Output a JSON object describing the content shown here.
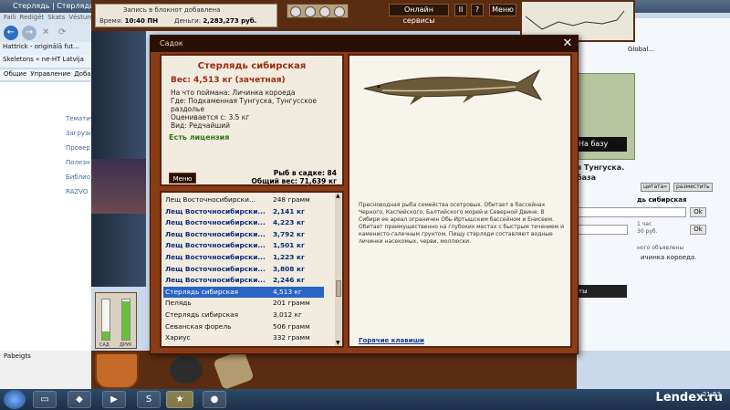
{
  "browser": {
    "title": "Стерлядь | Стерлядь сибир",
    "menu": [
      "Faili",
      "Rediģēt",
      "Skats",
      "Vēsture"
    ],
    "bookmarks": "Hattrick - originālā fut...",
    "tab": "Skeletons « ne-HT Latvija",
    "command_bar": [
      "Общие",
      "Управление",
      "Добавл"
    ],
    "left_links": [
      "Тематич",
      "Загрузи",
      "Провер",
      "Полезн",
      "Библио",
      "RAZVO"
    ],
    "right_tab_text": "Global...",
    "right_black_bar": "На базу",
    "right_bold_text": [
      "я Тунгуска.",
      "база"
    ],
    "right_buttons": [
      "цитата»",
      "разместить"
    ],
    "right_label": "дь сибирская",
    "right_ok": "Ok",
    "right_small": [
      "1 час",
      "30 руб.",
      "ного объявлены",
      "ичинка короеда."
    ],
    "right_dark_bar": "ты",
    "status": "Pabeigts"
  },
  "game": {
    "notebook_line1": "Запись в блокнот добавлена",
    "time_label": "Время:",
    "time_value": "10:40 ПН",
    "money_label": "Деньги:",
    "money_value": "2,283,273 руб.",
    "online_label": "Онлайн сервисы",
    "pause_label": "II",
    "help_label": "?",
    "menu_label": "Меню",
    "gauge_labels": [
      "САД",
      "ДРУК"
    ],
    "gauge_levels": [
      0.2,
      0.95
    ]
  },
  "dialog": {
    "title": "Садок",
    "fish_name": "Стерлядь сибирская",
    "weight_line": "Вес: 4,513 кг (зачетная)",
    "bait_line": "На что поймана: Личинка короеда",
    "where_line": "Где: Подкаменная Тунгуска, Тунгусское раздолье",
    "value_line": "Оценивается с: 3.5 кг",
    "kind_line": "Вид: Редчайший",
    "license": "Есть лицензия",
    "menu_button": "Меню",
    "fish_count": "Рыб в садке: 84",
    "total_weight": "Общий вес: 71,639 кг",
    "description": "Пресноводная рыба семейства осетровых. Обитает в бассейнах Черного, Каспийского, Балтийского морей и Северной Двине. В Сибири ее ареал ограничен Обь-Иртышским бассейном и Енисеем. Обитает преимущественно на глубоких местах с быстрым течением и каменисто-галечным грунтом. Пищу стерляди составляют водные личинки насекомых, черви, моллюски.",
    "hotkeys": "Горячие клавиши",
    "catch": [
      {
        "name": "Лещ Восточносибирски...",
        "weight": "248 грамм",
        "bold": false,
        "selected": false
      },
      {
        "name": "Лещ Восточносибирски...",
        "weight": "2,141 кг",
        "bold": true,
        "selected": false
      },
      {
        "name": "Лещ Восточносибирски...",
        "weight": "4,223 кг",
        "bold": true,
        "selected": false
      },
      {
        "name": "Лещ Восточносибирски...",
        "weight": "3,792 кг",
        "bold": true,
        "selected": false
      },
      {
        "name": "Лещ Восточносибирски...",
        "weight": "1,501 кг",
        "bold": true,
        "selected": false
      },
      {
        "name": "Лещ Восточносибирски...",
        "weight": "1,223 кг",
        "bold": true,
        "selected": false
      },
      {
        "name": "Лещ Восточносибирски...",
        "weight": "3,808 кг",
        "bold": true,
        "selected": false
      },
      {
        "name": "Лещ Восточносибирски...",
        "weight": "2,246 кг",
        "bold": true,
        "selected": false
      },
      {
        "name": "Стерлядь сибирская",
        "weight": "4,513 кг",
        "bold": false,
        "selected": true
      },
      {
        "name": "Пелядь",
        "weight": "201 грамм",
        "bold": false,
        "selected": false
      },
      {
        "name": "Стерлядь сибирская",
        "weight": "3,012 кг",
        "bold": false,
        "selected": false
      },
      {
        "name": "Севанская форель",
        "weight": "506 грамм",
        "bold": false,
        "selected": false
      },
      {
        "name": "Хариус",
        "weight": "332 грамм",
        "bold": false,
        "selected": false
      }
    ]
  },
  "taskbar": {
    "clock": "21:53",
    "watermark": "Lendex.ru"
  }
}
